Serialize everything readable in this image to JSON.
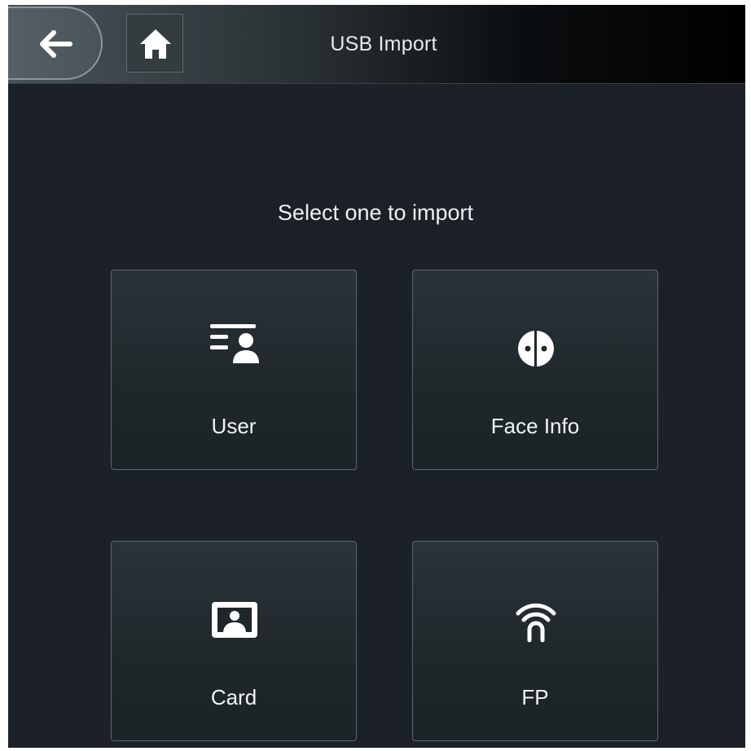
{
  "header": {
    "title": "USB Import",
    "back_icon": "arrow-left-icon",
    "home_icon": "home-icon"
  },
  "main": {
    "prompt": "Select one to import",
    "options": [
      {
        "label": "User",
        "icon": "user-list-icon"
      },
      {
        "label": "Face Info",
        "icon": "face-icon"
      },
      {
        "label": "Card",
        "icon": "id-card-icon"
      },
      {
        "label": "FP",
        "icon": "fingerprint-icon"
      }
    ]
  },
  "colors": {
    "background": "#1b2126",
    "tile_border": "#5c666b",
    "text": "#f2f4f5"
  }
}
